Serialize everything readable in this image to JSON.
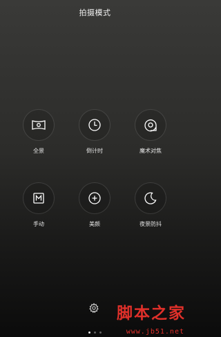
{
  "header": {
    "title": "拍摄模式"
  },
  "modes": [
    {
      "label": "全景",
      "icon": "panorama-icon"
    },
    {
      "label": "倒计时",
      "icon": "timer-clock-icon"
    },
    {
      "label": "魔术对焦",
      "icon": "magic-focus-icon"
    },
    {
      "label": "手动",
      "icon": "manual-m-icon"
    },
    {
      "label": "美颜",
      "icon": "beauty-icon"
    },
    {
      "label": "夜景防抖",
      "icon": "night-moon-icon"
    }
  ],
  "footer": {
    "settings_icon": "gear-icon",
    "page_count": 3,
    "active_page": 1
  },
  "watermark": {
    "title": "脚本之家",
    "url": "www.jb51.net"
  },
  "colors": {
    "watermark": "#e0302a",
    "text": "#ffffff"
  }
}
